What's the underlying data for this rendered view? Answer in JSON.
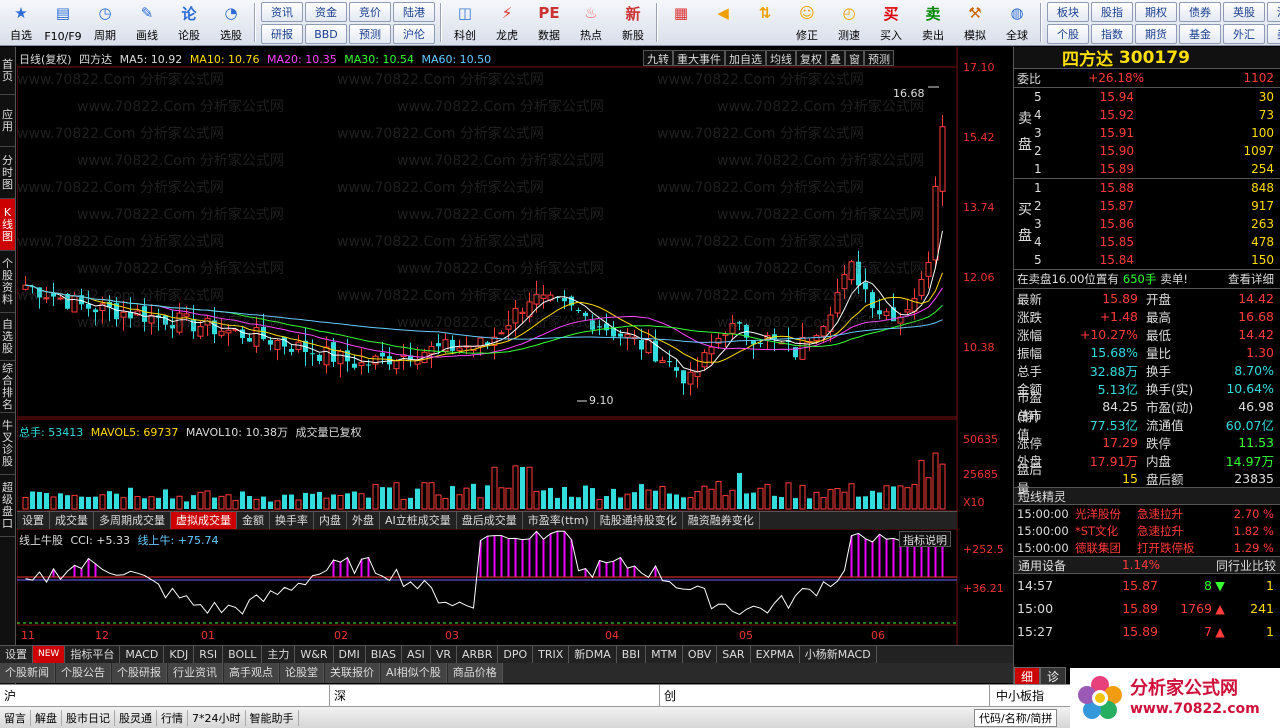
{
  "toolbar": {
    "buttons1": [
      {
        "label": "自选",
        "icon": "star-icon"
      },
      {
        "label": "F10/F9",
        "icon": "f10-icon"
      },
      {
        "label": "周期",
        "icon": "clock-icon"
      },
      {
        "label": "画线",
        "icon": "pencil-icon"
      },
      {
        "label": "论股",
        "icon": "discuss-icon"
      },
      {
        "label": "选股",
        "icon": "chart-pick-icon"
      }
    ],
    "grid1": [
      "资讯",
      "研报",
      "资金",
      "BBD",
      "竞价",
      "预测",
      "陆港",
      "沪伦"
    ],
    "buttons2": [
      {
        "label": "科创",
        "icon": "kechuang-icon"
      },
      {
        "label": "龙虎",
        "icon": "longhu-icon"
      },
      {
        "label": "数据",
        "icon": "data-icon"
      },
      {
        "label": "热点",
        "icon": "hot-icon"
      },
      {
        "label": "新股",
        "icon": "newstock-icon"
      }
    ],
    "buttons3": [
      {
        "label": "",
        "icon": "grid-icon"
      },
      {
        "label": "",
        "icon": "back-arrow-icon"
      },
      {
        "label": "",
        "icon": "updown-arrows-icon"
      },
      {
        "label": "修正",
        "icon": "fix-icon"
      },
      {
        "label": "测速",
        "icon": "speed-icon"
      },
      {
        "label": "买入",
        "icon": "buy-icon"
      },
      {
        "label": "卖出",
        "icon": "sell-icon"
      },
      {
        "label": "模拟",
        "icon": "hammer-icon"
      },
      {
        "label": "全球",
        "icon": "globe-icon"
      }
    ],
    "grid2": [
      "板块",
      "个股",
      "股指",
      "指数",
      "期权",
      "期货",
      "债券",
      "基金",
      "英股",
      "外汇",
      "港股",
      "美股"
    ]
  },
  "left_tabs": [
    "首页",
    "应用",
    "分时图",
    "K线图",
    "个股资料",
    "自选股",
    "综合排名",
    "牛叉诊股",
    "超级盘口"
  ],
  "chart": {
    "header_ma": {
      "mode": "日线(复权)",
      "name": "四方达",
      "ma5": "MA5: 10.92",
      "ma10": "MA10: 10.76",
      "ma20": "MA20: 10.35",
      "ma30": "MA30: 10.54",
      "ma60": "MA60: 10.50"
    },
    "tools": [
      "九转",
      "重大事件",
      "加自选",
      "均线",
      "复权",
      "叠",
      "窗",
      "预测"
    ],
    "price_axis": [
      "17.10",
      "15.42",
      "13.74",
      "12.06",
      "10.38"
    ],
    "high_label": "16.68",
    "low_label": "9.10",
    "vol_header": {
      "total": "总手: 53413",
      "mavol5": "MAVOL5: 69737",
      "mavol10": "MAVOL10: 10.38万",
      "note": "成交量已复权"
    },
    "vol_axis": [
      "50635",
      "25685",
      "X10"
    ],
    "vol_tabs": [
      "设置",
      "成交量",
      "多周期成交量",
      "虚拟成交量",
      "金额",
      "换手率",
      "内盘",
      "外盘",
      "AI立桩成交量",
      "盘后成交量",
      "市盈率(ttm)",
      "陆股通持股变化",
      "融资融券变化"
    ],
    "cci_header": {
      "name": "线上牛股",
      "cci": "CCI: +5.33",
      "line": "线上牛: +75.74"
    },
    "cci_btn": "指标说明",
    "cci_axis": [
      "+252.5",
      "+36.21"
    ],
    "months": [
      "11",
      "12",
      "01",
      "02",
      "03",
      "04",
      "05",
      "06"
    ],
    "watermark": "www.70822.Com 分析家公式网"
  },
  "chart_data": {
    "type": "candlestick",
    "title": "",
    "series": [
      {
        "name": "MA5",
        "values": [
          10.92
        ]
      },
      {
        "name": "MA10",
        "values": [
          10.76
        ]
      },
      {
        "name": "MA20",
        "values": [
          10.35
        ]
      },
      {
        "name": "MA30",
        "values": [
          10.54
        ]
      },
      {
        "name": "MA60",
        "values": [
          10.5
        ]
      }
    ],
    "ylim": [
      9.1,
      17.1
    ],
    "high": 16.68,
    "low": 9.1
  },
  "indicator_tabs": [
    "设置",
    "NEW",
    "指标平台",
    "MACD",
    "KDJ",
    "RSI",
    "BOLL",
    "主力",
    "W&R",
    "DMI",
    "BIAS",
    "ASI",
    "VR",
    "ARBR",
    "DPO",
    "TRIX",
    "新DMA",
    "BBI",
    "MTM",
    "OBV",
    "SAR",
    "EXPMA",
    "小杨新MACD"
  ],
  "news_tabs": [
    "个股新闻",
    "个股公告",
    "个股研报",
    "行业资讯",
    "高手观点",
    "论股堂",
    "关联报价",
    "AI相似个股",
    "商品价格"
  ],
  "right": {
    "stock_name": "四方达",
    "stock_code": "300179",
    "weibi": {
      "label": "委比",
      "pct": "+26.18%",
      "val": "1102"
    },
    "sell_label": "卖盘",
    "buy_label": "买盘",
    "asks": [
      {
        "lv": "5",
        "px": "15.94",
        "vol": "30"
      },
      {
        "lv": "4",
        "px": "15.92",
        "vol": "73"
      },
      {
        "lv": "3",
        "px": "15.91",
        "vol": "100"
      },
      {
        "lv": "2",
        "px": "15.90",
        "vol": "1097"
      },
      {
        "lv": "1",
        "px": "15.89",
        "vol": "254"
      }
    ],
    "bids": [
      {
        "lv": "1",
        "px": "15.88",
        "vol": "848"
      },
      {
        "lv": "2",
        "px": "15.87",
        "vol": "917"
      },
      {
        "lv": "3",
        "px": "15.86",
        "vol": "263"
      },
      {
        "lv": "4",
        "px": "15.85",
        "vol": "478"
      },
      {
        "lv": "5",
        "px": "15.84",
        "vol": "150"
      }
    ],
    "sell_info": {
      "text": "在卖盘16.00位置有",
      "qty": "650手",
      "tail": "卖单!",
      "btn": "查看详细"
    },
    "quotes": [
      {
        "k": "最新",
        "v": "15.89",
        "c": "red",
        "k2": "开盘",
        "v2": "14.42",
        "c2": "red"
      },
      {
        "k": "涨跌",
        "v": "+1.48",
        "c": "red",
        "k2": "最高",
        "v2": "16.68",
        "c2": "red"
      },
      {
        "k": "涨幅",
        "v": "+10.27%",
        "c": "red",
        "k2": "最低",
        "v2": "14.42",
        "c2": "red"
      },
      {
        "k": "振幅",
        "v": "15.68%",
        "c": "cyan",
        "k2": "量比",
        "v2": "1.30",
        "c2": "red"
      },
      {
        "k": "总手",
        "v": "32.88万",
        "c": "cyan",
        "k2": "换手",
        "v2": "8.70%",
        "c2": "cyan"
      },
      {
        "k": "金额",
        "v": "5.13亿",
        "c": "cyan",
        "k2": "换手(实)",
        "v2": "10.64%",
        "c2": "cyan"
      },
      {
        "k": "市盈(静)",
        "v": "84.25",
        "c": "white",
        "k2": "市盈(动)",
        "v2": "46.98",
        "c2": "white"
      },
      {
        "k": "总市值",
        "v": "77.53亿",
        "c": "cyan",
        "k2": "流通值",
        "v2": "60.07亿",
        "c2": "cyan"
      },
      {
        "k": "涨停",
        "v": "17.29",
        "c": "red",
        "k2": "跌停",
        "v2": "11.53",
        "c2": "green"
      },
      {
        "k": "外盘",
        "v": "17.91万",
        "c": "red",
        "k2": "内盘",
        "v2": "14.97万",
        "c2": "green"
      },
      {
        "k": "盘后量",
        "v": "15",
        "c": "yellow",
        "k2": "盘后额",
        "v2": "23835",
        "c2": "white"
      }
    ],
    "jingling_title": "短线精灵",
    "jingling": [
      {
        "t": "15:00:00",
        "n": "光洋股份",
        "e": "急速拉升",
        "p": "2.70 %"
      },
      {
        "t": "15:00:00",
        "n": "*ST文化",
        "e": "急速拉升",
        "p": "1.82 %"
      },
      {
        "t": "15:00:00",
        "n": "德联集团",
        "e": "打开跌停板",
        "p": "1.29 %"
      }
    ],
    "industry": {
      "name": "通用设备",
      "pct": "1.14%",
      "btn": "同行业比较"
    },
    "ticks": [
      {
        "t": "14:57",
        "p": "15.87",
        "v": "8",
        "arrow": "down",
        "n": "1"
      },
      {
        "t": "15:00",
        "p": "15.89",
        "v": "1769",
        "arrow": "up",
        "n": "241"
      },
      {
        "t": "15:27",
        "p": "15.89",
        "v": "7",
        "arrow": "up",
        "n": "1"
      }
    ],
    "tick_tabs": [
      "细",
      "诊"
    ]
  },
  "index_bar": {
    "sh": "沪",
    "sz": "深",
    "cy": "创",
    "small": "中小板指"
  },
  "status_bar": [
    "留言",
    "解盘",
    "股市日记",
    "股灵通",
    "行情",
    "7*24小时",
    "智能助手"
  ],
  "status_right": "代码/名称/简拼",
  "logo": {
    "title": "分析家公式网",
    "url": "www.70822.com"
  }
}
